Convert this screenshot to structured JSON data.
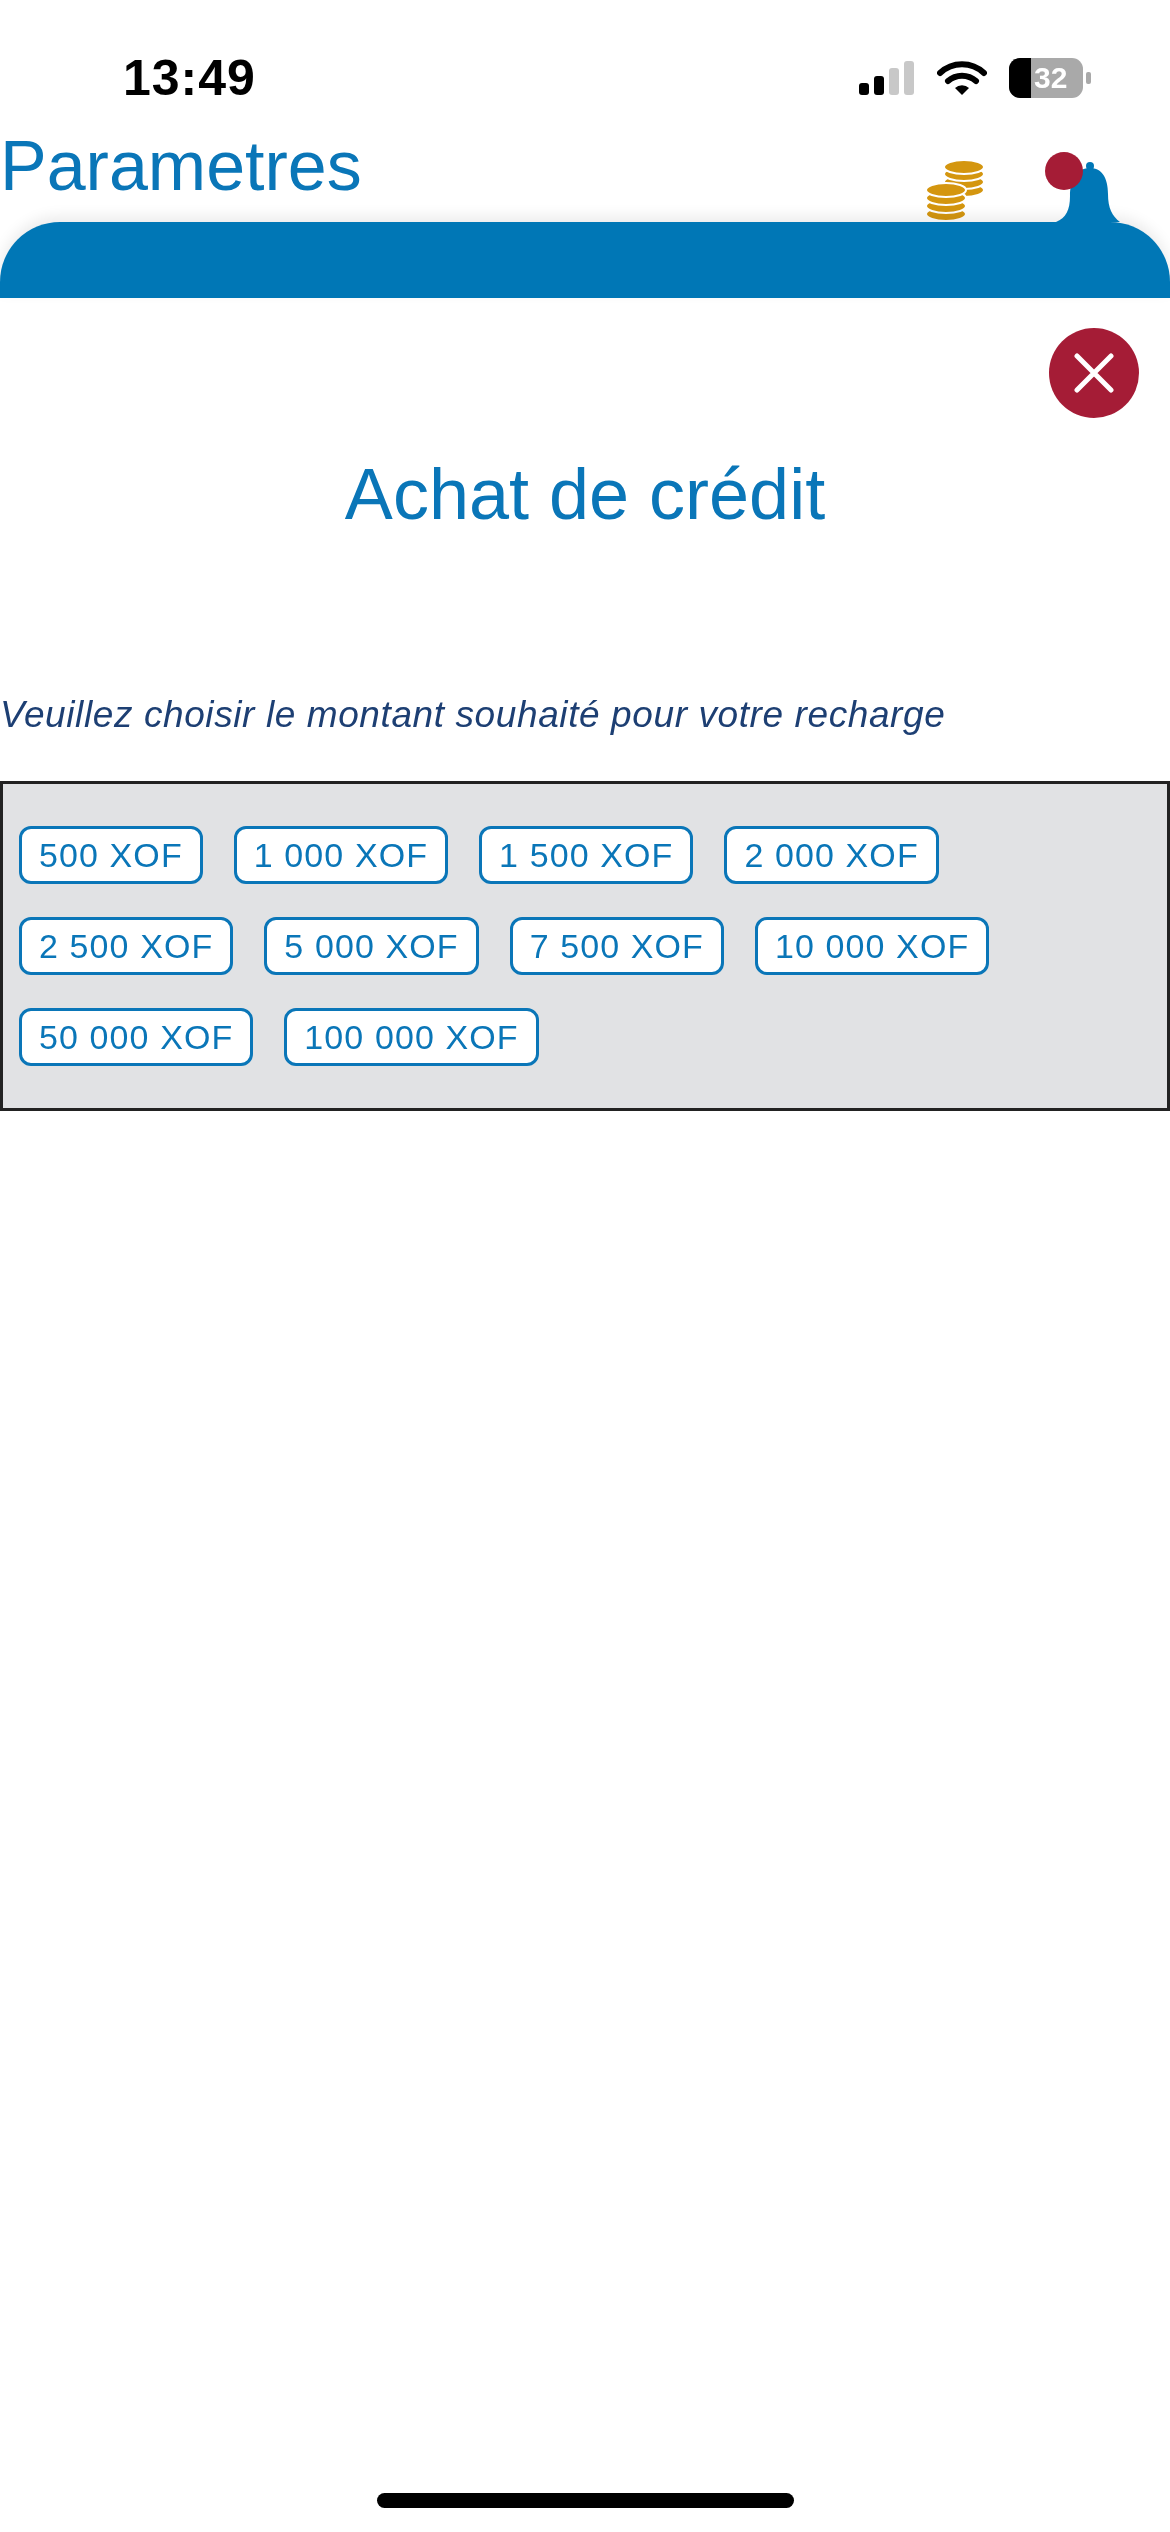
{
  "status_bar": {
    "time": "13:49",
    "battery": "32"
  },
  "header": {
    "title": "Parametres",
    "bell": {
      "badge": true
    }
  },
  "dialog": {
    "title": "Achat de crédit",
    "prompt": "Veuillez choisir le montant souhaité pour votre recharge",
    "amounts": [
      {
        "label": "500 XOF",
        "selected": false
      },
      {
        "label": "1 000 XOF",
        "selected": false
      },
      {
        "label": "1 500 XOF",
        "selected": false
      },
      {
        "label": "2 000 XOF",
        "selected": false
      },
      {
        "label": "2 500 XOF",
        "selected": false
      },
      {
        "label": "5 000 XOF",
        "selected": false
      },
      {
        "label": "7 500 XOF",
        "selected": false
      },
      {
        "label": "10 000 XOF",
        "selected": false
      },
      {
        "label": "50 000 XOF",
        "selected": false
      },
      {
        "label": "100 000 XOF",
        "selected": false
      }
    ]
  }
}
